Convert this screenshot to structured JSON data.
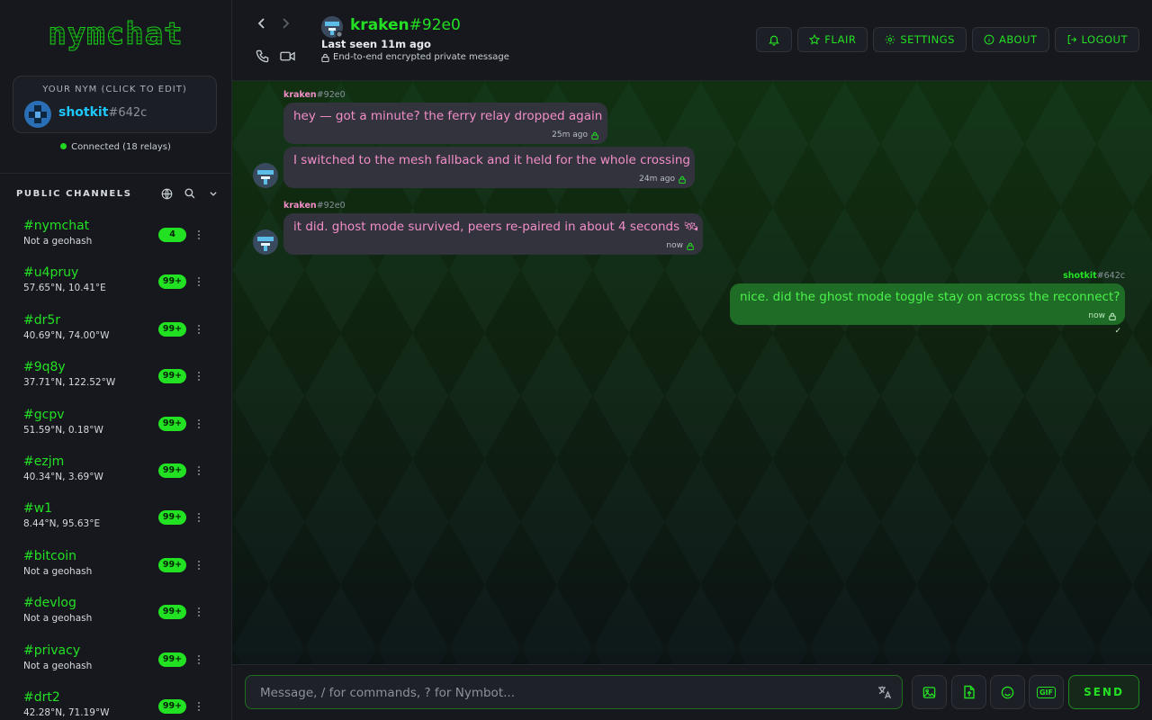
{
  "app": {
    "logo_text": "nymchat",
    "nym_caption": "YOUR NYM (CLICK TO EDIT)",
    "self_nick": "shotkit",
    "self_tag": "#642c",
    "connection_status": "Connected (18 relays)",
    "accent_color": "#24e024"
  },
  "channels": {
    "title": "PUBLIC CHANNELS",
    "icons": [
      "globe-icon",
      "search-icon",
      "chevron-down-icon"
    ],
    "items": [
      {
        "name": "#nymchat",
        "sub": "Not a geohash",
        "badge": "4"
      },
      {
        "name": "#u4pruy",
        "sub": "57.65°N, 10.41°E",
        "badge": "99+"
      },
      {
        "name": "#dr5r",
        "sub": "40.69°N, 74.00°W",
        "badge": "99+"
      },
      {
        "name": "#9q8y",
        "sub": "37.71°N, 122.52°W",
        "badge": "99+"
      },
      {
        "name": "#gcpv",
        "sub": "51.59°N, 0.18°W",
        "badge": "99+"
      },
      {
        "name": "#ezjm",
        "sub": "40.34°N, 3.69°W",
        "badge": "99+"
      },
      {
        "name": "#w1",
        "sub": "8.44°N, 95.63°E",
        "badge": "99+"
      },
      {
        "name": "#bitcoin",
        "sub": "Not a geohash",
        "badge": "99+"
      },
      {
        "name": "#devlog",
        "sub": "Not a geohash",
        "badge": "99+"
      },
      {
        "name": "#privacy",
        "sub": "Not a geohash",
        "badge": "99+"
      },
      {
        "name": "#drt2",
        "sub": "42.28°N, 71.19°W",
        "badge": "99+"
      }
    ]
  },
  "header": {
    "peer_nick": "kraken",
    "peer_tag": "#92e0",
    "last_seen": "Last seen 11m ago",
    "encryption_note": "End-to-end encrypted private message",
    "actions": {
      "flair": "FLAIR",
      "settings": "SETTINGS",
      "about": "ABOUT",
      "logout": "LOGOUT"
    }
  },
  "messages": [
    {
      "dir": "in",
      "sender_nick": "kraken",
      "sender_tag": "#92e0",
      "text": "hey — got a minute? the ferry relay dropped again",
      "time": "25m ago"
    },
    {
      "dir": "in",
      "sender_nick": "",
      "sender_tag": "",
      "text": "I switched to the mesh fallback and it held for the whole crossing",
      "time": "24m ago"
    },
    {
      "dir": "in",
      "sender_nick": "kraken",
      "sender_tag": "#92e0",
      "text": "it did. ghost mode survived, peers re-paired in about 4 seconds 🛰",
      "time": "now"
    },
    {
      "dir": "out",
      "sender_nick": "shotkit",
      "sender_tag": "#642c",
      "text": "nice. did the ghost mode toggle stay on across the reconnect?",
      "time": "now",
      "receipt": "✓"
    }
  ],
  "composer": {
    "placeholder": "Message, / for commands, ? for Nymbot...",
    "gif_label": "GIF",
    "send_label": "SEND"
  }
}
